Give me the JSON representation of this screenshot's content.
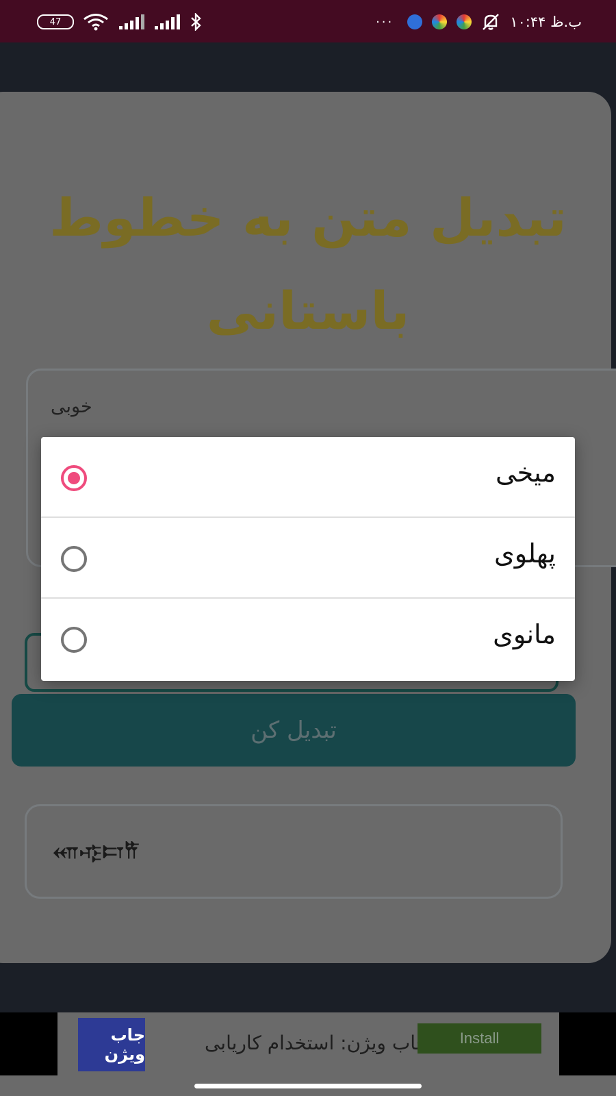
{
  "status_bar": {
    "battery": "47",
    "time": "۱۰:۴۴ ب.ظ",
    "overflow": "···"
  },
  "title": "تبدیل متن به خطوط باستانی",
  "input": {
    "value": "خوبی"
  },
  "dialog": {
    "options": [
      {
        "label": "میخی",
        "checked": true
      },
      {
        "label": "پهلوی",
        "checked": false
      },
      {
        "label": "مانوی",
        "checked": false
      }
    ]
  },
  "convert_button": {
    "label": "تبدیل کن"
  },
  "output": {
    "text": "𐎧𐎺𐎲𐎡"
  },
  "ad": {
    "brand": "جاب ویژن",
    "text": "جاب ویژن: استخدام کاریابی",
    "install_label": "Install"
  },
  "colors": {
    "status_bar": "#440b22",
    "accent_radio": "#ef4b7d",
    "title": "#7a6c24",
    "button": "#17474a"
  }
}
